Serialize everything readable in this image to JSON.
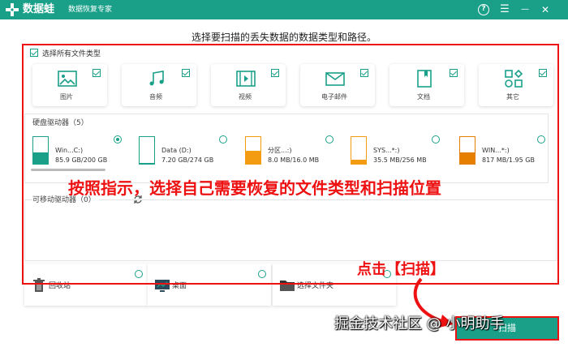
{
  "app": {
    "brand": "数据蛙",
    "subtitle": "数据恢复专家",
    "help_icon": "?",
    "menu_icon": "☰",
    "minimize_icon": "—",
    "close_icon": "✕"
  },
  "heading": "选择要扫描的丢失数据的数据类型和路径。",
  "select_all_label": "选择所有文件类型",
  "file_types": [
    {
      "name": "图片",
      "icon": "image-icon",
      "checked": true
    },
    {
      "name": "音频",
      "icon": "music-icon",
      "checked": true
    },
    {
      "name": "视频",
      "icon": "video-icon",
      "checked": true
    },
    {
      "name": "电子邮件",
      "icon": "mail-icon",
      "checked": true
    },
    {
      "name": "文档",
      "icon": "document-icon",
      "checked": true
    },
    {
      "name": "其它",
      "icon": "other-icon",
      "checked": true
    }
  ],
  "hard_drives_title": "硬盘驱动器（5）",
  "drives": [
    {
      "name": "Win...C:)",
      "size": "85.9 GB/200 GB",
      "used": 0.43,
      "color": "#1aa089",
      "selected": true
    },
    {
      "name": "Data (D:)",
      "size": "7.20 GB/274 GB",
      "used": 0.03,
      "color": "#1aa089",
      "selected": false
    },
    {
      "name": "分区...:)",
      "size": "8.0 MB/16.0 MB",
      "used": 0.5,
      "color": "#f39c12",
      "selected": false
    },
    {
      "name": "SYS...*:)",
      "size": "35.5 MB/256 MB",
      "used": 0.14,
      "color": "#f39c12",
      "selected": false
    },
    {
      "name": "WIN...*:)",
      "size": "817 MB/1.95 GB",
      "used": 0.41,
      "color": "#e67e00",
      "selected": false
    }
  ],
  "guide_text": "按照指示，选择自己需要恢复的文件类型和扫描位置",
  "removable_title": "可移动驱动器（0）",
  "locations": [
    {
      "name": "回收站",
      "icon": "recycle-bin-icon"
    },
    {
      "name": "桌面",
      "icon": "desktop-icon"
    },
    {
      "name": "选择文件夹",
      "icon": "folder-icon"
    }
  ],
  "click_scan_text": "点击【扫描】",
  "scan_button": "扫描",
  "watermark": "掘金技术社区 @ 小明助手",
  "colors": {
    "accent": "#1aa089",
    "annotation": "#ee1111",
    "orange": "#f39c12"
  }
}
